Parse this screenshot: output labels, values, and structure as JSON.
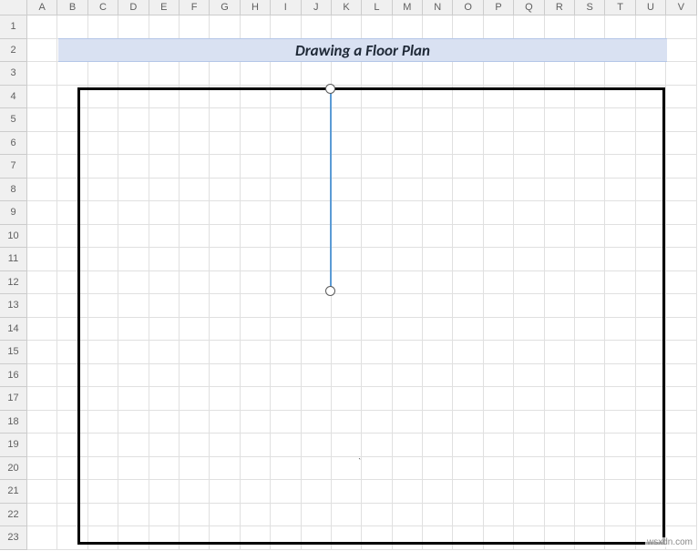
{
  "columns": [
    "A",
    "B",
    "C",
    "D",
    "E",
    "F",
    "G",
    "H",
    "I",
    "J",
    "K",
    "L",
    "M",
    "N",
    "O",
    "P",
    "Q",
    "R",
    "S",
    "T",
    "U",
    "V"
  ],
  "rows": [
    "1",
    "2",
    "3",
    "4",
    "5",
    "6",
    "7",
    "8",
    "9",
    "10",
    "11",
    "12",
    "13",
    "14",
    "15",
    "16",
    "17",
    "18",
    "19",
    "20",
    "21",
    "22",
    "23"
  ],
  "title": "Drawing a Floor Plan",
  "stray": "`",
  "watermark": "wsxdn.com"
}
